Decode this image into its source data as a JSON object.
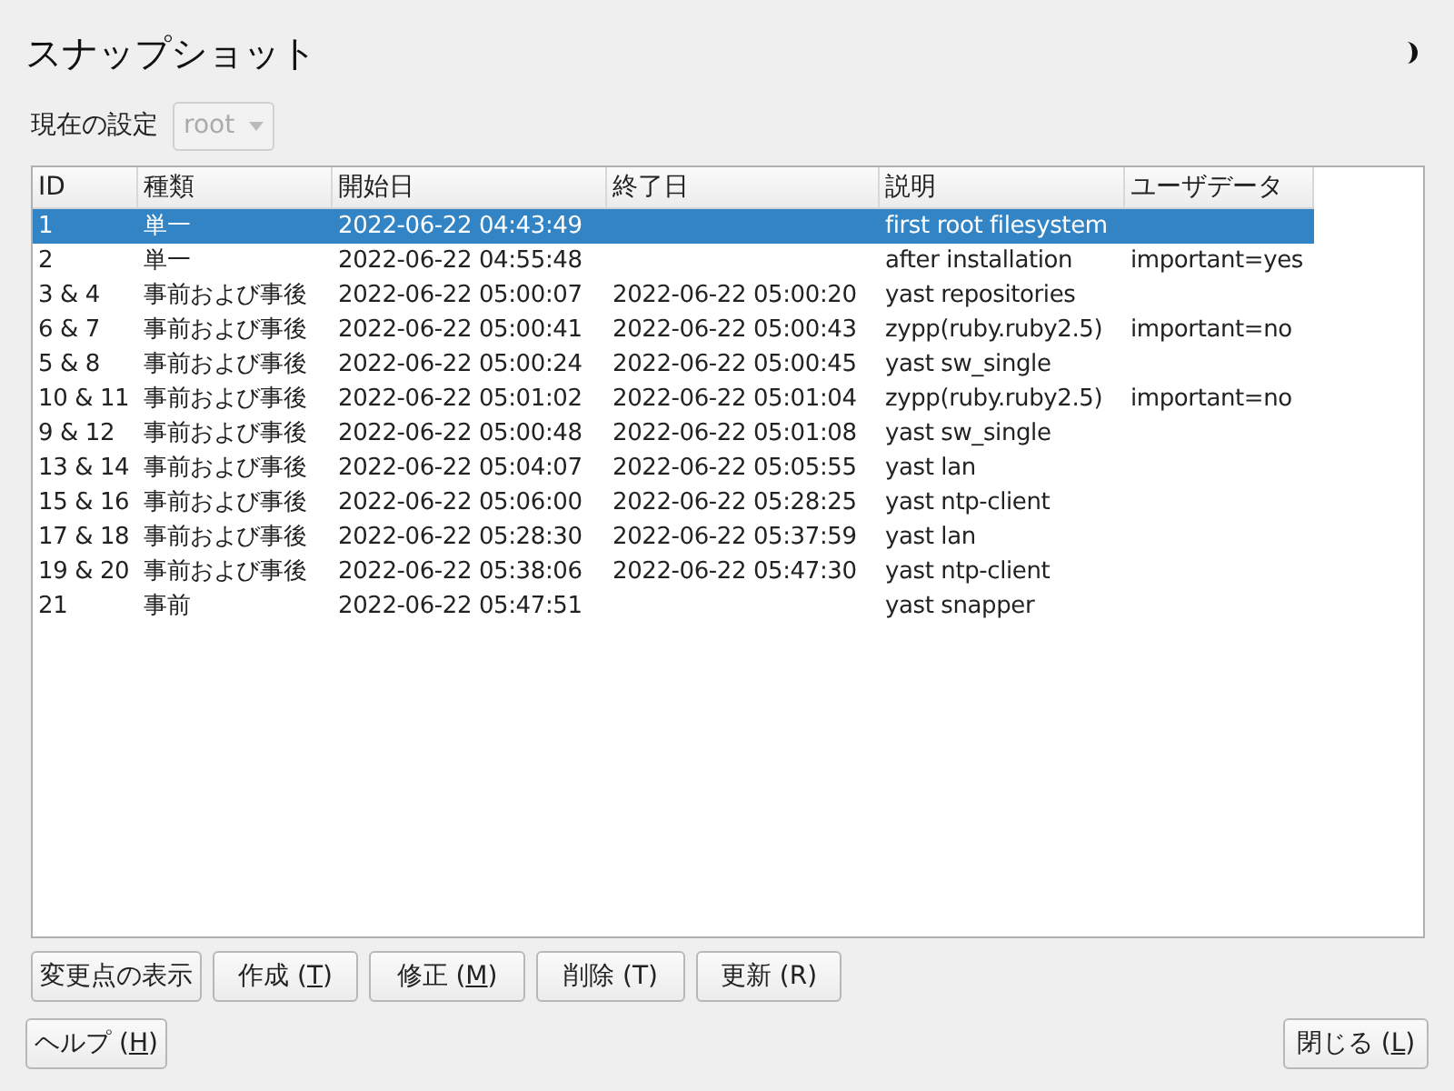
{
  "title": "スナップショット",
  "config": {
    "label": "現在の設定",
    "value": "root",
    "disabled": true
  },
  "table": {
    "columns": [
      "ID",
      "種類",
      "開始日",
      "終了日",
      "説明",
      "ユーザデータ"
    ],
    "rows": [
      {
        "cells": [
          "1",
          "単一",
          "2022-06-22 04:43:49",
          "",
          "first root filesystem",
          ""
        ],
        "selected": true
      },
      {
        "cells": [
          "2",
          "単一",
          "2022-06-22 04:55:48",
          "",
          "after installation",
          "important=yes"
        ],
        "selected": false
      },
      {
        "cells": [
          "3 & 4",
          "事前および事後",
          "2022-06-22 05:00:07",
          "2022-06-22 05:00:20",
          "yast repositories",
          ""
        ],
        "selected": false
      },
      {
        "cells": [
          "6 & 7",
          "事前および事後",
          "2022-06-22 05:00:41",
          "2022-06-22 05:00:43",
          "zypp(ruby.ruby2.5)",
          "important=no"
        ],
        "selected": false
      },
      {
        "cells": [
          "5 & 8",
          "事前および事後",
          "2022-06-22 05:00:24",
          "2022-06-22 05:00:45",
          "yast sw_single",
          ""
        ],
        "selected": false
      },
      {
        "cells": [
          "10 & 11",
          "事前および事後",
          "2022-06-22 05:01:02",
          "2022-06-22 05:01:04",
          "zypp(ruby.ruby2.5)",
          "important=no"
        ],
        "selected": false
      },
      {
        "cells": [
          "9 & 12",
          "事前および事後",
          "2022-06-22 05:00:48",
          "2022-06-22 05:01:08",
          "yast sw_single",
          ""
        ],
        "selected": false
      },
      {
        "cells": [
          "13 & 14",
          "事前および事後",
          "2022-06-22 05:04:07",
          "2022-06-22 05:05:55",
          "yast lan",
          ""
        ],
        "selected": false
      },
      {
        "cells": [
          "15 & 16",
          "事前および事後",
          "2022-06-22 05:06:00",
          "2022-06-22 05:28:25",
          "yast ntp-client",
          ""
        ],
        "selected": false
      },
      {
        "cells": [
          "17 & 18",
          "事前および事後",
          "2022-06-22 05:28:30",
          "2022-06-22 05:37:59",
          "yast lan",
          ""
        ],
        "selected": false
      },
      {
        "cells": [
          "19 & 20",
          "事前および事後",
          "2022-06-22 05:38:06",
          "2022-06-22 05:47:30",
          "yast ntp-client",
          ""
        ],
        "selected": false
      },
      {
        "cells": [
          "21",
          "事前",
          "2022-06-22 05:47:51",
          "",
          "yast snapper",
          ""
        ],
        "selected": false
      }
    ]
  },
  "actions": [
    {
      "pre": "変更点の表示"
    },
    {
      "pre": "作成 (",
      "accel": "T",
      "post": ")"
    },
    {
      "pre": "修正 (",
      "accel": "M",
      "post": ")"
    },
    {
      "pre": "削除 (T)"
    },
    {
      "pre": "更新 (R)"
    }
  ],
  "help": {
    "pre": "ヘルプ (",
    "accel": "H",
    "post": ")"
  },
  "close": {
    "pre": "閉じる (",
    "accel": "L",
    "post": ")"
  }
}
